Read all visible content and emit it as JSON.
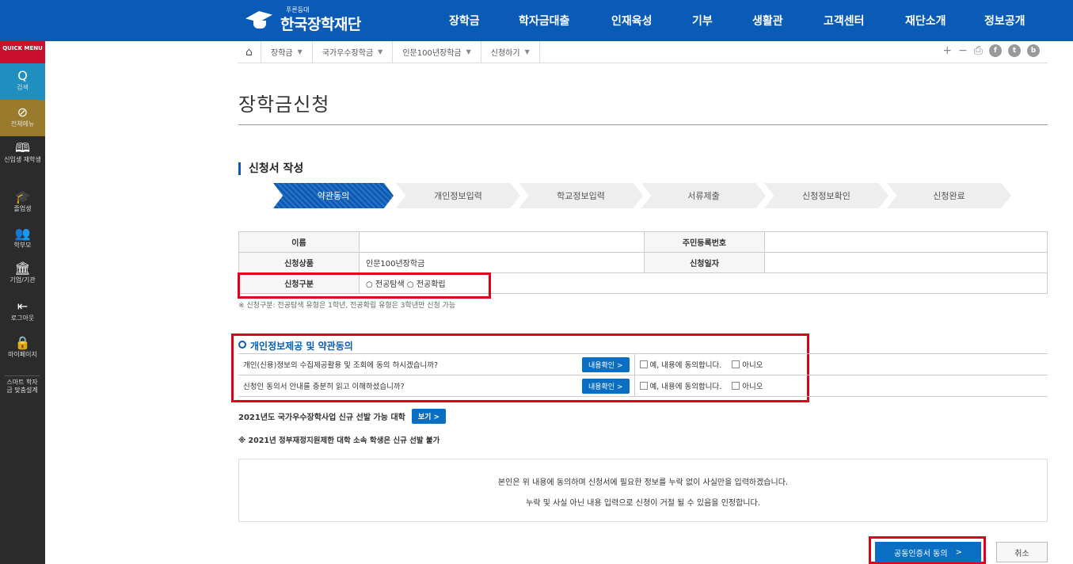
{
  "logo": {
    "small": "푸른등대",
    "name": "한국장학재단"
  },
  "gnb": [
    "장학금",
    "학자금대출",
    "인재육성",
    "기부",
    "생활관",
    "고객센터",
    "재단소개",
    "정보공개"
  ],
  "quick_menu": "QUICK MENU",
  "leftbar": [
    {
      "icon": "Q",
      "label": "검색"
    },
    {
      "icon": "⊘",
      "label": "전체메뉴"
    },
    {
      "icon": "🕮",
      "label": "신입생 재학생"
    },
    {
      "icon": "🎓",
      "label": "졸업생"
    },
    {
      "icon": "👥",
      "label": "학부모"
    },
    {
      "icon": "🏛",
      "label": "기업/기관"
    },
    {
      "icon": "⇤",
      "label": "로그아웃"
    },
    {
      "icon": "🔒",
      "label": "마이페이지"
    },
    {
      "icon": "",
      "label": "스마트 학자금 맞춤설계"
    }
  ],
  "breadcrumb": {
    "home": "⌂",
    "items": [
      "장학금",
      "국가우수장학금",
      "인문100년장학금",
      "신청하기"
    ],
    "arrow": "▼"
  },
  "tools": {
    "plus": "+",
    "minus": "−",
    "print": "⎙",
    "fb": "f",
    "tw": "t",
    "blog": "b"
  },
  "page_title": "장학금신청",
  "section_title": "신청서 작성",
  "steps": [
    "약관동의",
    "개인정보입력",
    "학교정보입력",
    "서류제출",
    "신청정보확인",
    "신청완료"
  ],
  "info": {
    "name_label": "이름",
    "name_value": "",
    "rrn_label": "주민등록번호",
    "rrn_value": "",
    "product_label": "신청상품",
    "product_value": "인문100년장학금",
    "date_label": "신청일자",
    "date_value": "",
    "type_label": "신청구분",
    "type_opt1": "전공탐색",
    "type_opt2": "전공확립"
  },
  "note1": "※ 신청구분: 전공탐색 유형은 1학년, 전공확립 유형은 3학년만 신청 가능",
  "agree": {
    "title": "개인정보제공 및 약관동의",
    "rows": [
      {
        "q": "개인(신용)정보의 수집제공활용 및 조회에 동의 하시겠습니까?",
        "btn": "내용확인 >",
        "yes": "예, 내용에 동의합니다.",
        "no": "아니오"
      },
      {
        "q": "신청인 동의서 안내를 충분히 읽고 이해하셨습니까?",
        "btn": "내용확인 >",
        "yes": "예, 내용에 동의합니다.",
        "no": "아니오"
      }
    ]
  },
  "univ": {
    "text": "2021년도 국가우수장학사업 신규 선발 가능 대학",
    "btn": "보기 >"
  },
  "note2": "※ 2021년 정부재정지원제한 대학 소속 학생은 신규 선발 불가",
  "confirm": {
    "line1": "본인은 위 내용에 동의하며 신청서에 필요한 정보를 누락 없이 사실만을 입력하겠습니다.",
    "line2": "누락 및 사실 아닌 내용 입력으로 신청이 거절 될 수 있음을 인정합니다."
  },
  "buttons": {
    "cert": "공동인증서 동의",
    "cert_arrow": ">",
    "cancel": "취소"
  },
  "colors": {
    "brand": "#0a5bb5",
    "highlight": "#e0001b",
    "button": "#0a6ec2"
  }
}
